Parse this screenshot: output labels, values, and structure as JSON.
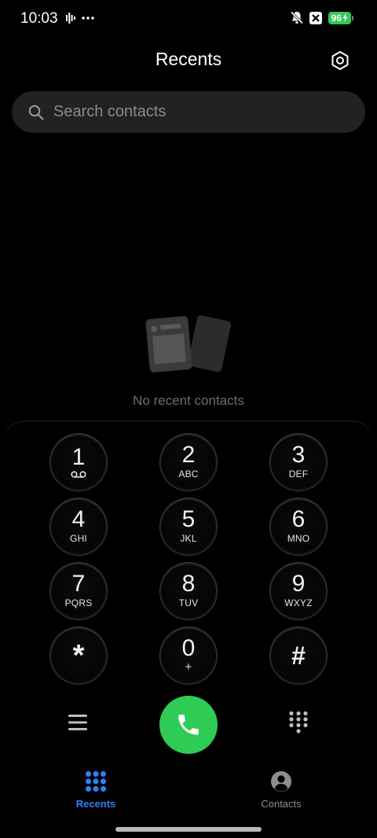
{
  "status_bar": {
    "time": "10:03",
    "battery_level": "96",
    "left_icons": [
      "voice-waveform-icon",
      "more-dots-icon"
    ],
    "right_icons": [
      "silent-bell-icon",
      "x-app-icon",
      "battery-charging-icon"
    ]
  },
  "header": {
    "title": "Recents",
    "settings_icon": "hexagon-settings-icon"
  },
  "search": {
    "placeholder": "Search contacts"
  },
  "empty_state": {
    "message": "No recent contacts"
  },
  "dialpad": {
    "keys": [
      {
        "digit": "1",
        "letters": ""
      },
      {
        "digit": "2",
        "letters": "ABC"
      },
      {
        "digit": "3",
        "letters": "DEF"
      },
      {
        "digit": "4",
        "letters": "GHI"
      },
      {
        "digit": "5",
        "letters": "JKL"
      },
      {
        "digit": "6",
        "letters": "MNO"
      },
      {
        "digit": "7",
        "letters": "PQRS"
      },
      {
        "digit": "8",
        "letters": "TUV"
      },
      {
        "digit": "9",
        "letters": "WXYZ"
      },
      {
        "digit": "*",
        "letters": ""
      },
      {
        "digit": "0",
        "letters": "+"
      },
      {
        "digit": "#",
        "letters": ""
      }
    ]
  },
  "bottom_nav": {
    "tabs": [
      {
        "label": "Recents",
        "icon": "dialpad-grid-icon",
        "active": true
      },
      {
        "label": "Contacts",
        "icon": "person-circle-icon",
        "active": false
      }
    ]
  },
  "colors": {
    "background": "#000000",
    "accent": "#2f7df6",
    "call_green": "#2ecc55",
    "battery_green": "#34c759"
  }
}
